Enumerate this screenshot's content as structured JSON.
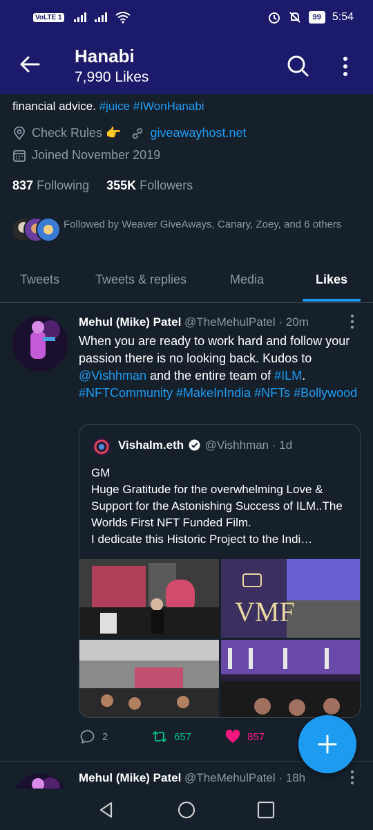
{
  "status_bar": {
    "volte": "VoLTE 1",
    "battery": "99",
    "time": "5:54"
  },
  "header": {
    "title": "Hanabi",
    "subtitle": "7,990 Likes"
  },
  "profile": {
    "bio_prefix": "financial advice.",
    "bio_tag1": "#juice",
    "bio_tag2": "#IWonHanabi",
    "check_rules": "Check Rules 👉",
    "website": "giveawayhost.net",
    "joined": "Joined November 2019",
    "following_count": "837",
    "following_label": "Following",
    "followers_count": "355K",
    "followers_label": "Followers",
    "followed_by": "Followed by Weaver GiveAways, Canary, Zoey, and 6 others"
  },
  "tabs": [
    {
      "label": "Tweets"
    },
    {
      "label": "Tweets & replies"
    },
    {
      "label": "Media"
    },
    {
      "label": "Likes"
    }
  ],
  "tweet": {
    "name": "Mehul (Mike) Patel",
    "handle": "@TheMehulPatel",
    "time": "· 20m",
    "text_1": "When you are ready to work hard and follow your passion there is no looking back. Kudos to",
    "mention": "@Vishhman",
    "text_2": "and the entire team of",
    "tag_ilm": "#ILM",
    "text_3": ".",
    "tags": "#NFTCommunity #MakeInIndia #NFTs #Bollywood",
    "quote": {
      "name": "Vishalm.eth",
      "handle": "@Vishhman",
      "time": "· 1d",
      "text": "GM\nHuge Gratitude for the overwhelming Love & Support for the Astonishing Success of ILM..The Worlds First NFT Funded Film.\nI dedicate this Historic Project to the Indi…"
    },
    "replies": "2",
    "retweets": "657",
    "likes": "857"
  },
  "tweet2": {
    "name": "Mehul (Mike) Patel",
    "handle": "@TheMehulPatel",
    "time": "· 18h"
  },
  "colors": {
    "header_bg": "#1b1a6b",
    "page_bg": "#15202b",
    "accent": "#1d9bf0",
    "retweet": "#00ba7c",
    "like": "#f91880"
  }
}
